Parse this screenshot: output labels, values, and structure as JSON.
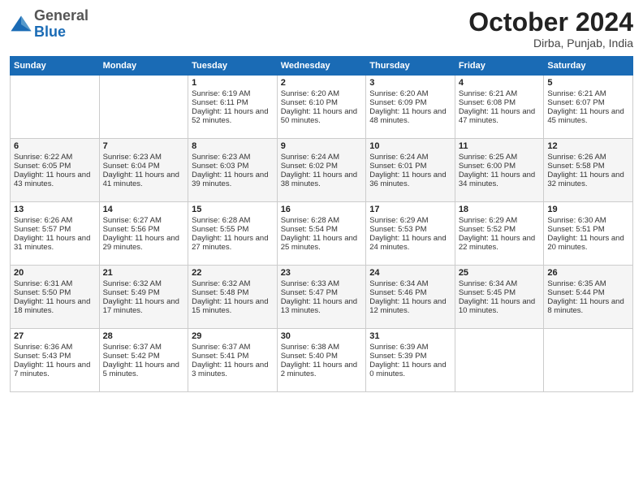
{
  "logo": {
    "general": "General",
    "blue": "Blue"
  },
  "title": "October 2024",
  "location": "Dirba, Punjab, India",
  "days_header": [
    "Sunday",
    "Monday",
    "Tuesday",
    "Wednesday",
    "Thursday",
    "Friday",
    "Saturday"
  ],
  "weeks": [
    {
      "cells": [
        {
          "day": "",
          "content": ""
        },
        {
          "day": "",
          "content": ""
        },
        {
          "day": "1",
          "sunrise": "Sunrise: 6:19 AM",
          "sunset": "Sunset: 6:11 PM",
          "daylight": "Daylight: 11 hours and 52 minutes."
        },
        {
          "day": "2",
          "sunrise": "Sunrise: 6:20 AM",
          "sunset": "Sunset: 6:10 PM",
          "daylight": "Daylight: 11 hours and 50 minutes."
        },
        {
          "day": "3",
          "sunrise": "Sunrise: 6:20 AM",
          "sunset": "Sunset: 6:09 PM",
          "daylight": "Daylight: 11 hours and 48 minutes."
        },
        {
          "day": "4",
          "sunrise": "Sunrise: 6:21 AM",
          "sunset": "Sunset: 6:08 PM",
          "daylight": "Daylight: 11 hours and 47 minutes."
        },
        {
          "day": "5",
          "sunrise": "Sunrise: 6:21 AM",
          "sunset": "Sunset: 6:07 PM",
          "daylight": "Daylight: 11 hours and 45 minutes."
        }
      ]
    },
    {
      "cells": [
        {
          "day": "6",
          "sunrise": "Sunrise: 6:22 AM",
          "sunset": "Sunset: 6:05 PM",
          "daylight": "Daylight: 11 hours and 43 minutes."
        },
        {
          "day": "7",
          "sunrise": "Sunrise: 6:23 AM",
          "sunset": "Sunset: 6:04 PM",
          "daylight": "Daylight: 11 hours and 41 minutes."
        },
        {
          "day": "8",
          "sunrise": "Sunrise: 6:23 AM",
          "sunset": "Sunset: 6:03 PM",
          "daylight": "Daylight: 11 hours and 39 minutes."
        },
        {
          "day": "9",
          "sunrise": "Sunrise: 6:24 AM",
          "sunset": "Sunset: 6:02 PM",
          "daylight": "Daylight: 11 hours and 38 minutes."
        },
        {
          "day": "10",
          "sunrise": "Sunrise: 6:24 AM",
          "sunset": "Sunset: 6:01 PM",
          "daylight": "Daylight: 11 hours and 36 minutes."
        },
        {
          "day": "11",
          "sunrise": "Sunrise: 6:25 AM",
          "sunset": "Sunset: 6:00 PM",
          "daylight": "Daylight: 11 hours and 34 minutes."
        },
        {
          "day": "12",
          "sunrise": "Sunrise: 6:26 AM",
          "sunset": "Sunset: 5:58 PM",
          "daylight": "Daylight: 11 hours and 32 minutes."
        }
      ]
    },
    {
      "cells": [
        {
          "day": "13",
          "sunrise": "Sunrise: 6:26 AM",
          "sunset": "Sunset: 5:57 PM",
          "daylight": "Daylight: 11 hours and 31 minutes."
        },
        {
          "day": "14",
          "sunrise": "Sunrise: 6:27 AM",
          "sunset": "Sunset: 5:56 PM",
          "daylight": "Daylight: 11 hours and 29 minutes."
        },
        {
          "day": "15",
          "sunrise": "Sunrise: 6:28 AM",
          "sunset": "Sunset: 5:55 PM",
          "daylight": "Daylight: 11 hours and 27 minutes."
        },
        {
          "day": "16",
          "sunrise": "Sunrise: 6:28 AM",
          "sunset": "Sunset: 5:54 PM",
          "daylight": "Daylight: 11 hours and 25 minutes."
        },
        {
          "day": "17",
          "sunrise": "Sunrise: 6:29 AM",
          "sunset": "Sunset: 5:53 PM",
          "daylight": "Daylight: 11 hours and 24 minutes."
        },
        {
          "day": "18",
          "sunrise": "Sunrise: 6:29 AM",
          "sunset": "Sunset: 5:52 PM",
          "daylight": "Daylight: 11 hours and 22 minutes."
        },
        {
          "day": "19",
          "sunrise": "Sunrise: 6:30 AM",
          "sunset": "Sunset: 5:51 PM",
          "daylight": "Daylight: 11 hours and 20 minutes."
        }
      ]
    },
    {
      "cells": [
        {
          "day": "20",
          "sunrise": "Sunrise: 6:31 AM",
          "sunset": "Sunset: 5:50 PM",
          "daylight": "Daylight: 11 hours and 18 minutes."
        },
        {
          "day": "21",
          "sunrise": "Sunrise: 6:32 AM",
          "sunset": "Sunset: 5:49 PM",
          "daylight": "Daylight: 11 hours and 17 minutes."
        },
        {
          "day": "22",
          "sunrise": "Sunrise: 6:32 AM",
          "sunset": "Sunset: 5:48 PM",
          "daylight": "Daylight: 11 hours and 15 minutes."
        },
        {
          "day": "23",
          "sunrise": "Sunrise: 6:33 AM",
          "sunset": "Sunset: 5:47 PM",
          "daylight": "Daylight: 11 hours and 13 minutes."
        },
        {
          "day": "24",
          "sunrise": "Sunrise: 6:34 AM",
          "sunset": "Sunset: 5:46 PM",
          "daylight": "Daylight: 11 hours and 12 minutes."
        },
        {
          "day": "25",
          "sunrise": "Sunrise: 6:34 AM",
          "sunset": "Sunset: 5:45 PM",
          "daylight": "Daylight: 11 hours and 10 minutes."
        },
        {
          "day": "26",
          "sunrise": "Sunrise: 6:35 AM",
          "sunset": "Sunset: 5:44 PM",
          "daylight": "Daylight: 11 hours and 8 minutes."
        }
      ]
    },
    {
      "cells": [
        {
          "day": "27",
          "sunrise": "Sunrise: 6:36 AM",
          "sunset": "Sunset: 5:43 PM",
          "daylight": "Daylight: 11 hours and 7 minutes."
        },
        {
          "day": "28",
          "sunrise": "Sunrise: 6:37 AM",
          "sunset": "Sunset: 5:42 PM",
          "daylight": "Daylight: 11 hours and 5 minutes."
        },
        {
          "day": "29",
          "sunrise": "Sunrise: 6:37 AM",
          "sunset": "Sunset: 5:41 PM",
          "daylight": "Daylight: 11 hours and 3 minutes."
        },
        {
          "day": "30",
          "sunrise": "Sunrise: 6:38 AM",
          "sunset": "Sunset: 5:40 PM",
          "daylight": "Daylight: 11 hours and 2 minutes."
        },
        {
          "day": "31",
          "sunrise": "Sunrise: 6:39 AM",
          "sunset": "Sunset: 5:39 PM",
          "daylight": "Daylight: 11 hours and 0 minutes."
        },
        {
          "day": "",
          "content": ""
        },
        {
          "day": "",
          "content": ""
        }
      ]
    }
  ]
}
